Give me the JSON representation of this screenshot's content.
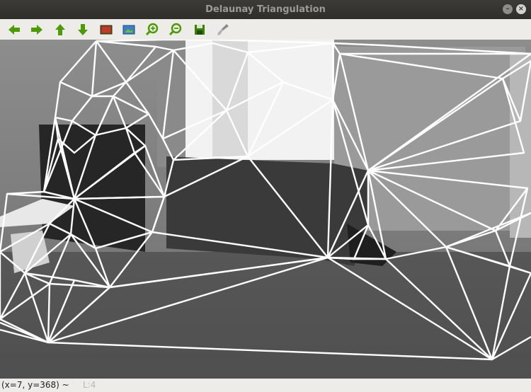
{
  "window": {
    "title": "Delaunay Triangulation",
    "minimize_glyph": "–",
    "close_glyph": "×"
  },
  "toolbar": {
    "buttons": [
      {
        "name": "pan-left",
        "icon": "arrow-left-icon"
      },
      {
        "name": "pan-right",
        "icon": "arrow-right-icon"
      },
      {
        "name": "pan-up",
        "icon": "arrow-up-icon"
      },
      {
        "name": "pan-down",
        "icon": "arrow-down-icon"
      },
      {
        "name": "zoom-fit",
        "icon": "image-icon"
      },
      {
        "name": "zoom-original",
        "icon": "photo-icon"
      },
      {
        "name": "zoom-in",
        "icon": "zoom-in-icon"
      },
      {
        "name": "zoom-out",
        "icon": "zoom-out-icon"
      },
      {
        "name": "save",
        "icon": "floppy-icon"
      },
      {
        "name": "properties",
        "icon": "brush-icon"
      }
    ],
    "colors": {
      "arrow": "#4e9a06",
      "magnifier": "#4e9a06",
      "floppy": "#3a7f0a"
    }
  },
  "status": {
    "position_text": "(x=7, y=368) ~",
    "extra_text": "L:4"
  },
  "colors": {
    "titlebar": "#3c3b37",
    "title_text": "#9a9a96",
    "toolbar": "#eeece9",
    "edge": "#ffffff"
  }
}
